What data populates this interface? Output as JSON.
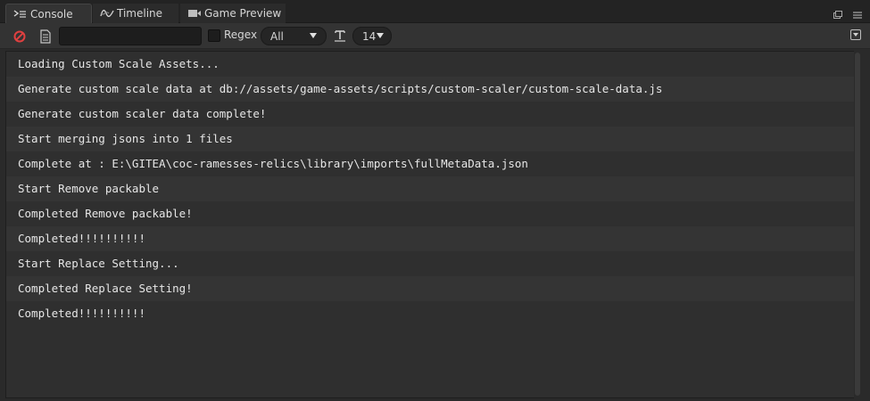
{
  "tabs": [
    {
      "label": "Console",
      "icon": "console-icon",
      "active": true
    },
    {
      "label": "Timeline",
      "icon": "timeline-icon",
      "active": false
    },
    {
      "label": "Game Preview",
      "icon": "camera-icon",
      "active": false
    }
  ],
  "toolbar": {
    "filter_value": "",
    "regex_label": "Regex",
    "regex_checked": false,
    "level_value": "All",
    "font_size_value": "14"
  },
  "logs": [
    "Loading Custom Scale Assets...",
    "Generate custom scale data at db://assets/game-assets/scripts/custom-scaler/custom-scale-data.js",
    "Generate custom scaler data complete!",
    "Start merging jsons into 1 files",
    "Complete at : E:\\GITEA\\coc-ramesses-relics\\library\\imports\\fullMetaData.json",
    "Start Remove packable",
    "Completed Remove packable!",
    "Completed!!!!!!!!!!",
    "Start Replace Setting...",
    "Completed Replace Setting!",
    "Completed!!!!!!!!!!"
  ],
  "colors": {
    "clear_icon": "#e04040",
    "text": "#e6e6e6",
    "background": "#2f2f2f"
  }
}
